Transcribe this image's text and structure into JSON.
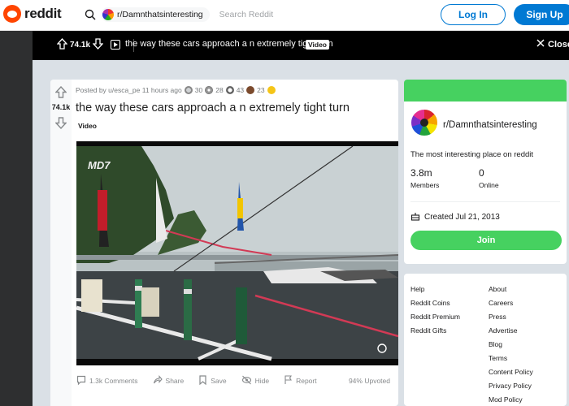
{
  "header": {
    "logo_text": "reddit",
    "subreddit_pill": "r/Damnthatsinteresting",
    "search_placeholder": "Search Reddit",
    "login_label": "Log In",
    "signup_label": "Sign Up"
  },
  "postbar": {
    "score": "74.1k",
    "title": "the way these cars approach a n extremely tight turn",
    "tag": "Video",
    "close_label": "Close"
  },
  "post": {
    "score": "74.1k",
    "meta": "Posted by u/esca_pe 11 hours ago",
    "awards": [
      {
        "icon": "silver-award-icon",
        "count": "30"
      },
      {
        "icon": "helpful-award-icon",
        "count": "28"
      },
      {
        "icon": "wholesome-award-icon",
        "count": "43"
      },
      {
        "icon": "bear-award-icon",
        "count": "23"
      }
    ],
    "title": "the way these cars approach a n extremely tight turn",
    "flair": "Video",
    "video_watermark": "MD7",
    "actions": {
      "comments": "1.3k Comments",
      "share": "Share",
      "save": "Save",
      "hide": "Hide",
      "report": "Report",
      "upvoted": "94% Upvoted"
    }
  },
  "community": {
    "name": "r/Damnthatsinteresting",
    "description": "The most interesting place on reddit",
    "members_count": "3.8m",
    "members_label": "Members",
    "online_count": "0",
    "online_label": "Online",
    "created": "Created Jul 21, 2013",
    "join_label": "Join"
  },
  "footer_links": {
    "left": [
      "Help",
      "Reddit Coins",
      "Reddit Premium",
      "Reddit Gifts"
    ],
    "right": [
      "About",
      "Careers",
      "Press",
      "Advertise",
      "Blog",
      "Terms",
      "Content Policy",
      "Privacy Policy",
      "Mod Policy"
    ]
  },
  "colors": {
    "brand": "#ff4500",
    "accent_blue": "#0079d3",
    "join_green": "#46d160"
  }
}
